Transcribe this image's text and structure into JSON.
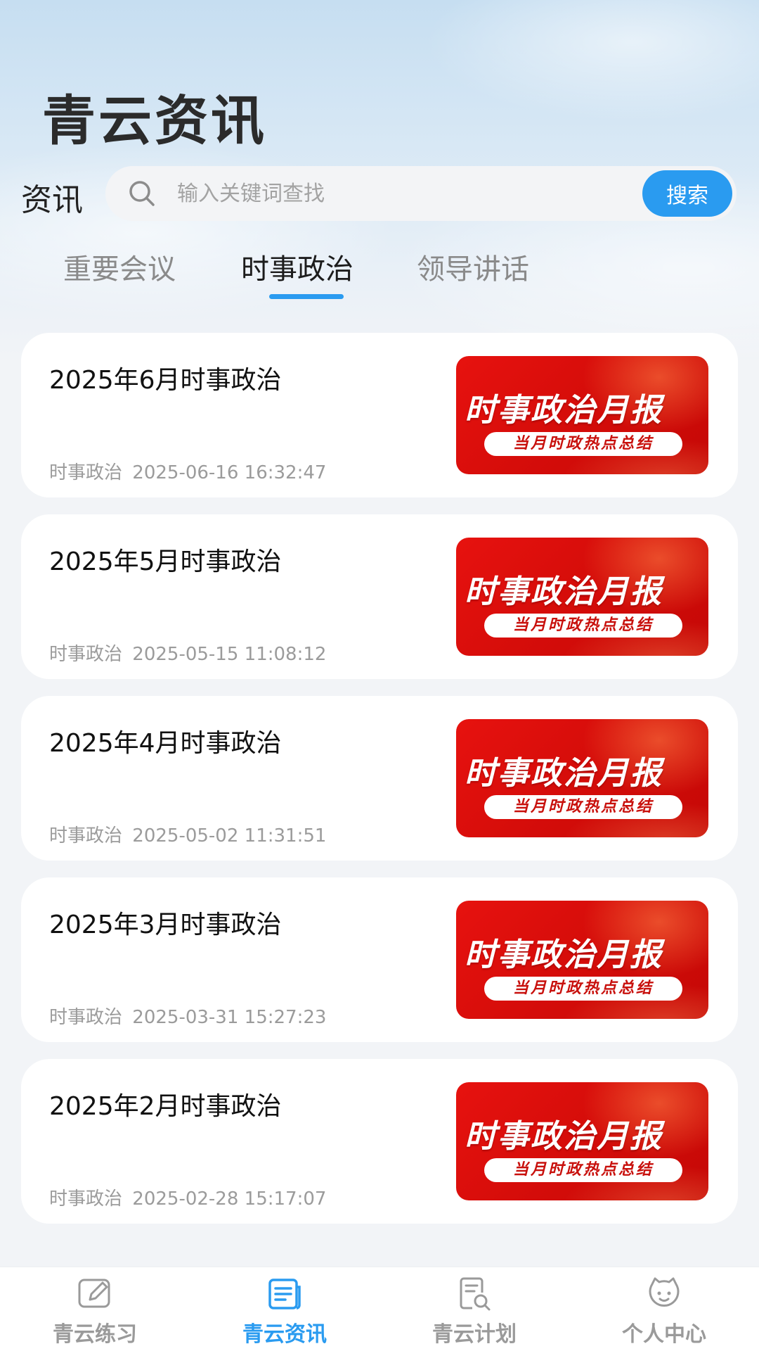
{
  "header": {
    "app_title": "青云资讯",
    "section_label": "资讯"
  },
  "search": {
    "placeholder": "输入关键词查找",
    "button_label": "搜索"
  },
  "tabs": [
    {
      "label": "重要会议",
      "active": false
    },
    {
      "label": "时事政治",
      "active": true
    },
    {
      "label": "领导讲话",
      "active": false
    }
  ],
  "articles": [
    {
      "title": "2025年6月时事政治",
      "category": "时事政治",
      "time": "2025-06-16 16:32:47",
      "thumb_title": "时事政治月报",
      "thumb_subtitle": "当月时政热点总结"
    },
    {
      "title": "2025年5月时事政治",
      "category": "时事政治",
      "time": "2025-05-15 11:08:12",
      "thumb_title": "时事政治月报",
      "thumb_subtitle": "当月时政热点总结"
    },
    {
      "title": "2025年4月时事政治",
      "category": "时事政治",
      "time": "2025-05-02 11:31:51",
      "thumb_title": "时事政治月报",
      "thumb_subtitle": "当月时政热点总结"
    },
    {
      "title": "2025年3月时事政治",
      "category": "时事政治",
      "time": "2025-03-31 15:27:23",
      "thumb_title": "时事政治月报",
      "thumb_subtitle": "当月时政热点总结"
    },
    {
      "title": "2025年2月时事政治",
      "category": "时事政治",
      "time": "2025-02-28 15:17:07",
      "thumb_title": "时事政治月报",
      "thumb_subtitle": "当月时政热点总结"
    }
  ],
  "bottom_nav": [
    {
      "label": "青云练习",
      "icon": "edit-icon",
      "active": false
    },
    {
      "label": "青云资讯",
      "icon": "news-icon",
      "active": true
    },
    {
      "label": "青云计划",
      "icon": "plan-search-icon",
      "active": false
    },
    {
      "label": "个人中心",
      "icon": "profile-face-icon",
      "active": false
    }
  ],
  "colors": {
    "accent": "#2a9bf0",
    "thumb_red": "#e01410",
    "inactive": "#9a9a9a"
  }
}
